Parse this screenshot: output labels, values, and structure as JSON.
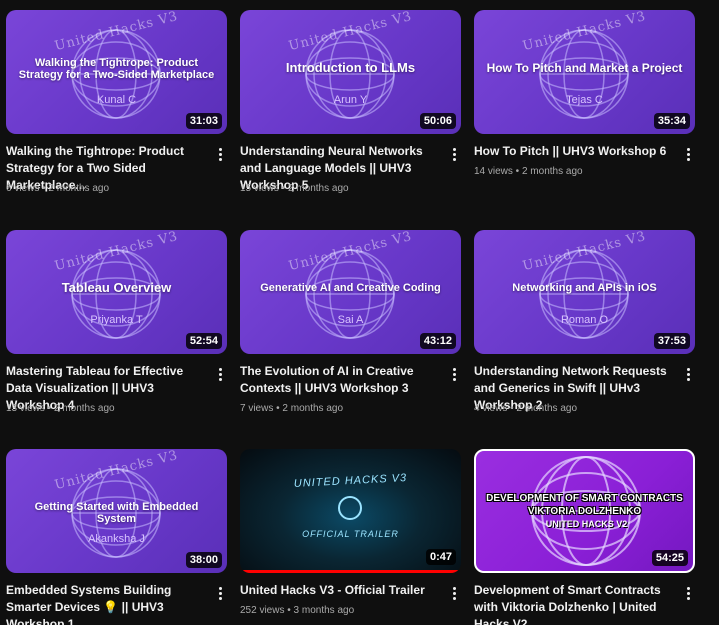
{
  "colors": {
    "background": "#0f0f0f",
    "thumb_purple": "#6f3fd0",
    "progress": "#ff0000"
  },
  "videos": [
    {
      "thumb_brand": "United Hacks V3",
      "thumb_title": "Walking the Tightrope: Product Strategy for a Two-Sided Marketplace",
      "thumb_speaker": "Kunal C",
      "duration": "31:03",
      "title": "Walking the Tightrope: Product Strategy for a Two Sided Marketplace...",
      "views": "6 views",
      "age": "2 months ago"
    },
    {
      "thumb_brand": "United Hacks V3",
      "thumb_title": "Introduction to LLMs",
      "thumb_speaker": "Arun Y",
      "duration": "50:06",
      "title": "Understanding Neural Networks and Language Models || UHV3 Workshop 5",
      "views": "15 views",
      "age": "2 months ago"
    },
    {
      "thumb_brand": "United Hacks V3",
      "thumb_title": "How To Pitch and Market a Project",
      "thumb_speaker": "Tejas C",
      "duration": "35:34",
      "title": "How To Pitch || UHV3 Workshop 6",
      "views": "14 views",
      "age": "2 months ago"
    },
    {
      "thumb_brand": "United Hacks V3",
      "thumb_title": "Tableau Overview",
      "thumb_speaker": "Priyanka T",
      "duration": "52:54",
      "title": "Mastering Tableau for Effective Data Visualization || UHV3 Workshop 4",
      "views": "13 views",
      "age": "2 months ago"
    },
    {
      "thumb_brand": "United Hacks V3",
      "thumb_title": "Generative AI and Creative Coding",
      "thumb_speaker": "Sai A",
      "duration": "43:12",
      "title": "The Evolution of AI in Creative Contexts || UHV3 Workshop 3",
      "views": "7 views",
      "age": "2 months ago"
    },
    {
      "thumb_brand": "United Hacks V3",
      "thumb_title": "Networking and APIs in iOS",
      "thumb_speaker": "Roman O",
      "duration": "37:53",
      "title": "Understanding Network Requests and Generics in Swift || UHv3 Workshop 2",
      "views": "4 views",
      "age": "2 months ago"
    },
    {
      "thumb_brand": "United Hacks V3",
      "thumb_title": "Getting Started with Embedded System",
      "thumb_speaker": "Akanksha J",
      "duration": "38:00",
      "title": "Embedded Systems Building Smarter Devices 💡 || UHV3 Workshop 1",
      "views": "",
      "age": ""
    },
    {
      "thumb_brand": "UNITED HACKS V3",
      "thumb_title": "OFFICIAL TRAILER",
      "thumb_speaker": "",
      "duration": "0:47",
      "watched_fraction": 1.0,
      "title": "United Hacks V3 - Official Trailer",
      "views": "252 views",
      "age": "3 months ago"
    },
    {
      "thumb_brand": "UNITED HACKS V2",
      "thumb_title": "DEVELOPMENT OF SMART CONTRACTS VIKTORIA DOLZHENKO",
      "thumb_speaker": "",
      "duration": "54:25",
      "title": "Development of Smart Contracts with Viktoria Dolzhenko | United Hacks V2...",
      "views": "",
      "age": ""
    }
  ]
}
